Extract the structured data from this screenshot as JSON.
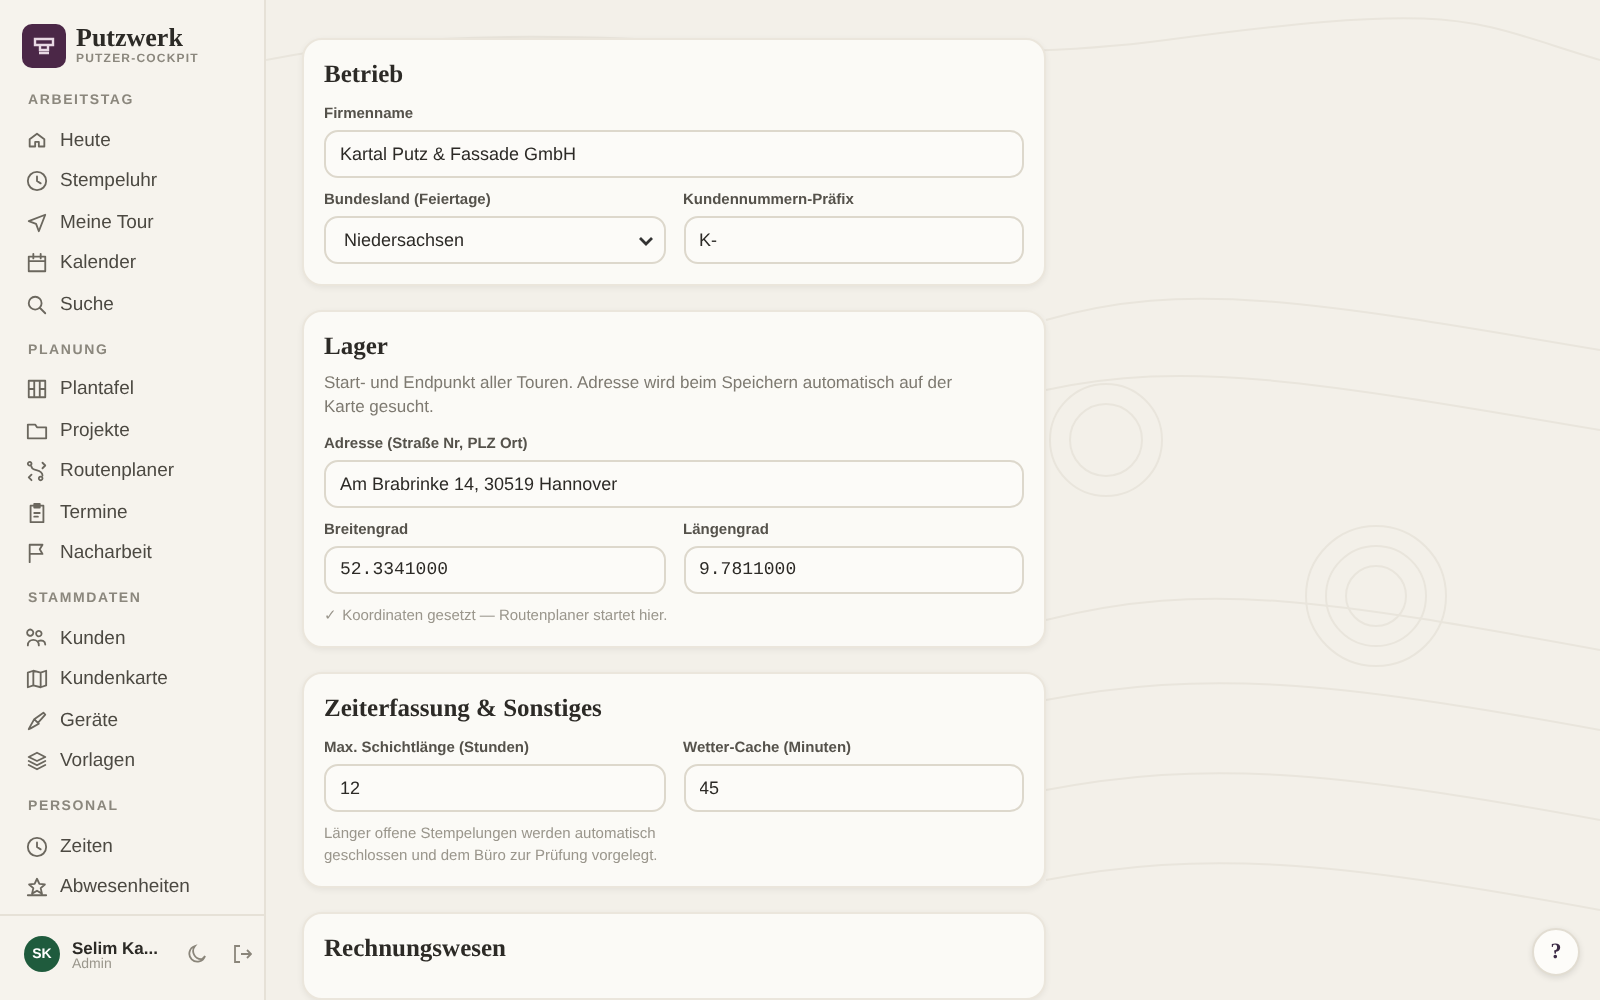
{
  "sidebar": {
    "brand": {
      "name": "Putzwerk",
      "subtitle": "PUTZER-COCKPIT"
    },
    "sections": [
      {
        "title": "ARBEITSTAG",
        "items": [
          {
            "label": "Heute"
          },
          {
            "label": "Stempeluhr"
          },
          {
            "label": "Meine Tour"
          },
          {
            "label": "Kalender"
          },
          {
            "label": "Suche"
          }
        ]
      },
      {
        "title": "PLANUNG",
        "items": [
          {
            "label": "Plantafel"
          },
          {
            "label": "Projekte"
          },
          {
            "label": "Routenplaner"
          },
          {
            "label": "Termine"
          },
          {
            "label": "Nacharbeit"
          }
        ]
      },
      {
        "title": "STAMMDATEN",
        "items": [
          {
            "label": "Kunden"
          },
          {
            "label": "Kundenkarte"
          },
          {
            "label": "Geräte"
          },
          {
            "label": "Vorlagen"
          }
        ]
      },
      {
        "title": "PERSONAL",
        "items": [
          {
            "label": "Zeiten"
          },
          {
            "label": "Abwesenheiten"
          }
        ]
      }
    ],
    "user": {
      "initials": "SK",
      "name": "Selim Ka...",
      "role": "Admin"
    }
  },
  "cards": [
    {
      "title": "Betrieb",
      "rows": [
        [
          {
            "label": "Firmenname",
            "value": "Kartal Putz & Fassade GmbH",
            "kind": "text"
          }
        ],
        [
          {
            "label": "Bundesland (Feiertage)",
            "value": "Niedersachsen",
            "kind": "select"
          },
          {
            "label": "Kundennummern-Präfix",
            "value": "K-",
            "kind": "text"
          }
        ]
      ]
    },
    {
      "title": "Lager",
      "description": "Start- und Endpunkt aller Touren. Adresse wird beim Speichern automatisch auf der Karte gesucht.",
      "rows": [
        [
          {
            "label": "Adresse (Straße Nr, PLZ Ort)",
            "value": "Am Brabrinke 14, 30519 Hannover",
            "kind": "text"
          }
        ],
        [
          {
            "label": "Breitengrad",
            "value": "52.3341000",
            "kind": "mono"
          },
          {
            "label": "Längengrad",
            "value": "9.7811000",
            "kind": "mono"
          }
        ]
      ],
      "hint": "✓ Koordinaten gesetzt — Routenplaner startet hier."
    },
    {
      "title": "Zeiterfassung & Sonstiges",
      "rows": [
        [
          {
            "label": "Max. Schichtlänge (Stunden)",
            "value": "12",
            "kind": "text"
          },
          {
            "label": "Wetter-Cache (Minuten)",
            "value": "45",
            "kind": "text"
          }
        ]
      ],
      "hint": "Länger offene Stempelungen werden automatisch geschlossen und dem Büro zur Prüfung vorgelegt."
    },
    {
      "title": "Rechnungswesen"
    }
  ],
  "help_button": "?"
}
